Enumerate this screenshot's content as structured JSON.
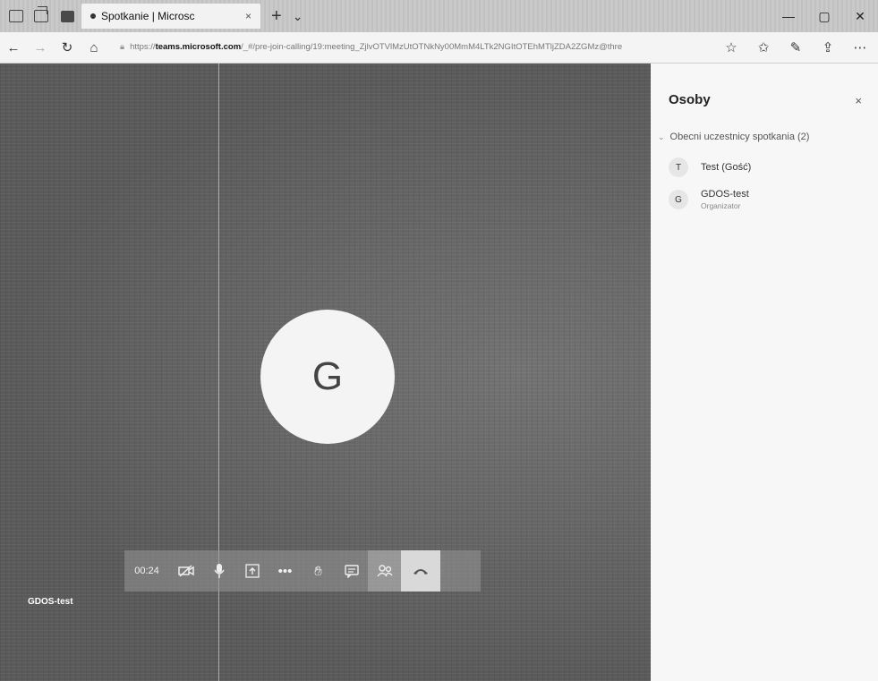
{
  "browser": {
    "tab_title": "Spotkanie | Microsc",
    "tab_close": "×",
    "new_tab": "+",
    "tab_menu": "⌄",
    "window_controls": [
      "—",
      "▢",
      "✕"
    ]
  },
  "address": {
    "url_prefix": "https://",
    "url_host": "teams.microsoft.com",
    "url_path": "/_#/pre-join-calling/19:meeting_ZjlvOTVlMzUtOTNkNy00MmM4LTk2NGItOTEhMTljZDA2ZGMz@thre",
    "icons": [
      "back-arrow-icon",
      "forward-arrow-icon",
      "refresh-icon",
      "home-icon",
      "star-icon",
      "favorites-icon",
      "pen-icon",
      "share-icon",
      "more-icon"
    ]
  },
  "stage": {
    "avatar_letter": "G",
    "participant_label": "GDOS-test"
  },
  "toolbar": {
    "timer": "00:24"
  },
  "panel": {
    "title": "Osoby",
    "close": "×",
    "section_label": "Obecni uczestnicy spotkania (2)",
    "people": [
      {
        "initial": "T",
        "name": "Test (Gość)",
        "role": ""
      },
      {
        "initial": "G",
        "name": "GDOS-test",
        "role": "Organizator"
      }
    ]
  }
}
